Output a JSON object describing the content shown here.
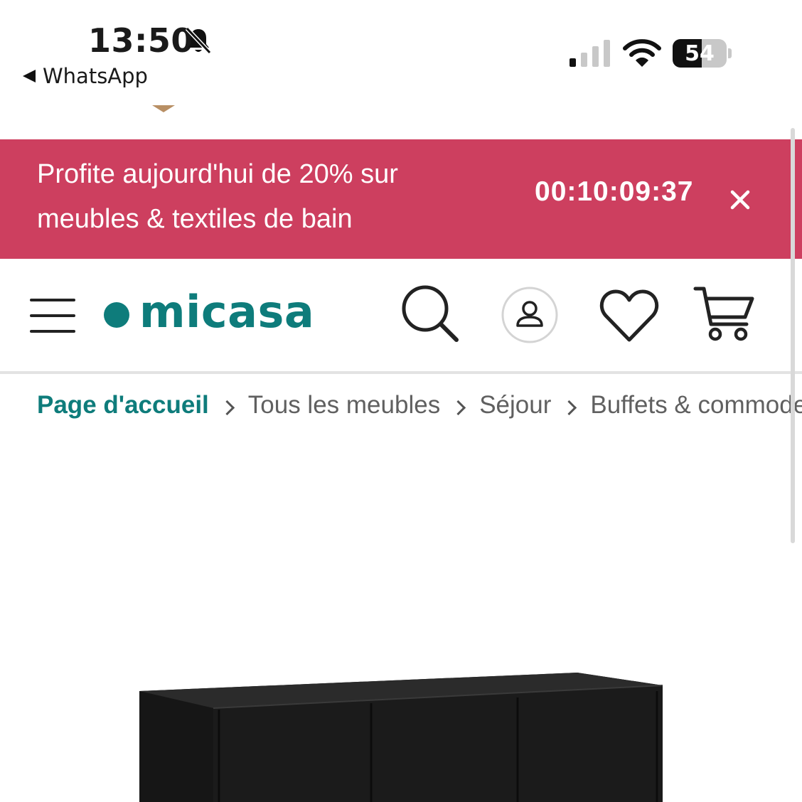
{
  "status_bar": {
    "time": "13:50",
    "back_app": "WhatsApp",
    "battery_percent": "54",
    "battery_level": 0.54,
    "icons": [
      "bell-slash-icon",
      "cellular-signal-icon",
      "wifi-icon",
      "battery-icon"
    ]
  },
  "promo": {
    "line1": "Profite aujourd'hui de 20% sur",
    "line2": "meubles & textiles de bain",
    "countdown": "00:10:09:37"
  },
  "header": {
    "logo": "micasa",
    "brand_color": "#0e7c7b",
    "promo_color": "#cd3f5f",
    "icons": [
      "menu-icon",
      "search-icon",
      "account-icon",
      "heart-icon",
      "cart-icon"
    ]
  },
  "breadcrumb": {
    "items": [
      "Page d'accueil",
      "Tous les meubles",
      "Séjour",
      "Buffets & commodes"
    ]
  },
  "product": {
    "image": "black-sideboard-image"
  }
}
